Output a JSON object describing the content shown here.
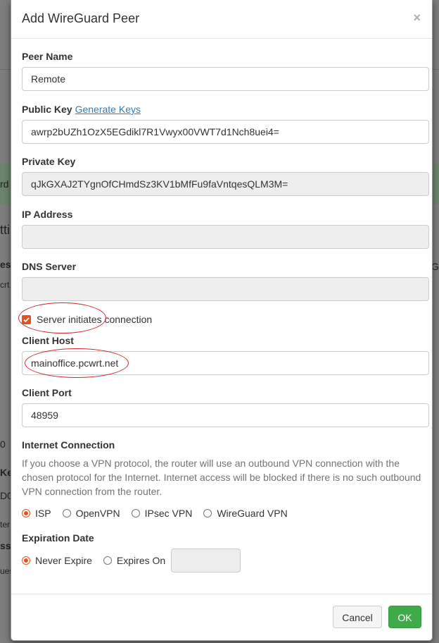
{
  "background": {
    "fragments": [
      "rd",
      "tti",
      "ess",
      "crt.r",
      "0",
      "Ke",
      "D0",
      "ter",
      "ss",
      "ues",
      "Gu"
    ]
  },
  "modal": {
    "title": "Add WireGuard Peer",
    "close_glyph": "×",
    "peer_name": {
      "label": "Peer Name",
      "value": "Remote"
    },
    "public_key": {
      "label": "Public Key",
      "link": "Generate Keys",
      "value": "awrp2bUZh1OzX5EGdikl7R1Vwyx00VWT7d1Nch8uei4="
    },
    "private_key": {
      "label": "Private Key",
      "value": "qJkGXAJ2TYgnOfCHmdSz3KV1bMfFu9faVntqesQLM3M="
    },
    "ip_address": {
      "label": "IP Address",
      "value": ""
    },
    "dns_server": {
      "label": "DNS Server",
      "value": ""
    },
    "server_initiates": {
      "label": "Server initiates connection",
      "checked": true
    },
    "client_host": {
      "label": "Client Host",
      "value": "mainoffice.pcwrt.net"
    },
    "client_port": {
      "label": "Client Port",
      "value": "48959"
    },
    "internet_connection": {
      "label": "Internet Connection",
      "help": "If you choose a VPN protocol, the router will use an outbound VPN connection with the chosen protocol for the Internet. Internet access will be blocked if there is no such outbound VPN connection from the router.",
      "options": [
        "ISP",
        "OpenVPN",
        "IPsec VPN",
        "WireGuard VPN"
      ],
      "selected": "ISP"
    },
    "expiration_date": {
      "label": "Expiration Date",
      "options": [
        "Never Expire",
        "Expires On"
      ],
      "selected": "Never Expire",
      "date_value": ""
    },
    "footer": {
      "cancel": "Cancel",
      "ok": "OK"
    }
  },
  "colors": {
    "accent": "#e8511c",
    "ok_button": "#3eaa48",
    "link": "#337ab7",
    "annotation": "#d0262b"
  }
}
